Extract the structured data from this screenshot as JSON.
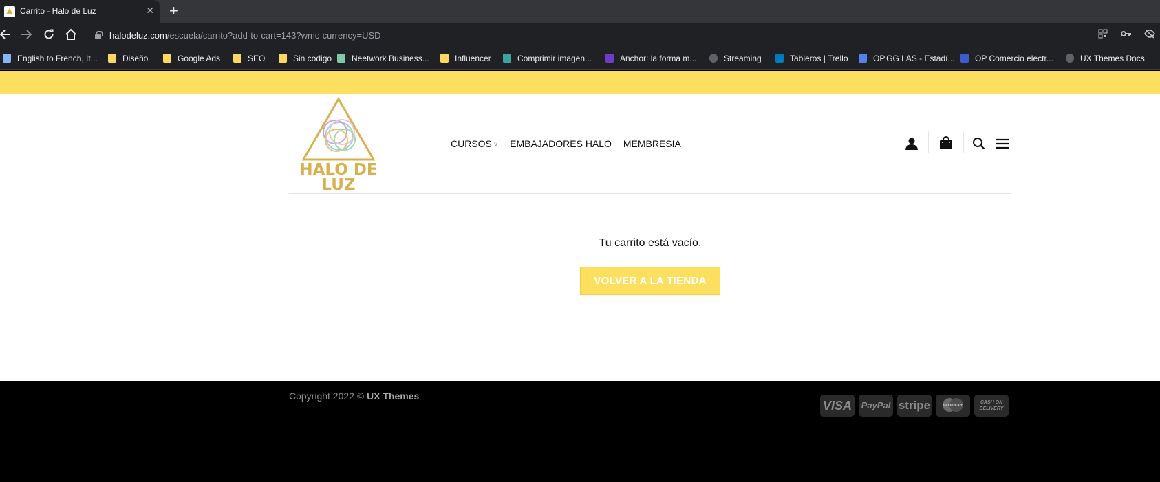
{
  "browser": {
    "tab_title": "Carrito - Halo de Luz",
    "close_glyph": "✕",
    "newtab_glyph": "+",
    "url_host": "halodeluz.com",
    "url_path": "/escuela/carrito?add-to-cart=143?wmc-currency=USD",
    "bookmarks": [
      {
        "label": "English to French, It...",
        "icon": "translate-icon",
        "color": "#8ab4f8"
      },
      {
        "label": "Diseño",
        "icon": "folder-icon",
        "color": "#fdd663"
      },
      {
        "label": "Google Ads",
        "icon": "folder-icon",
        "color": "#fdd663"
      },
      {
        "label": "SEO",
        "icon": "folder-icon",
        "color": "#fdd663"
      },
      {
        "label": "Sin codigo",
        "icon": "folder-icon",
        "color": "#fdd663"
      },
      {
        "label": "Neetwork Business...",
        "icon": "neetwork-icon",
        "color": "#7fc8a9"
      },
      {
        "label": "Influencer",
        "icon": "folder-icon",
        "color": "#fdd663"
      },
      {
        "label": "Comprimir imagen...",
        "icon": "leaf-icon",
        "color": "#3ba4a0"
      },
      {
        "label": "Anchor: la forma m...",
        "icon": "anchor-icon",
        "color": "#6e3cc7"
      },
      {
        "label": "Streaming",
        "icon": "globe-icon",
        "color": "#5f6368"
      },
      {
        "label": "Tableros | Trello",
        "icon": "trello-icon",
        "color": "#0079bf"
      },
      {
        "label": "OP.GG LAS - Estadí...",
        "icon": "opgg-icon",
        "color": "#5383e8"
      },
      {
        "label": "OP Comercio electr...",
        "icon": "op-icon",
        "color": "#3b5ccc"
      },
      {
        "label": "UX Themes Docs",
        "icon": "ux-icon",
        "color": "#5f6368"
      }
    ]
  },
  "site": {
    "logo_text": "HALO DE LUZ",
    "brand_color": "#d9b04f",
    "accent": "#fddf5f",
    "menu": [
      {
        "label": "CURSOS",
        "has_dropdown": true
      },
      {
        "label": "EMBAJADORES HALO",
        "has_dropdown": false
      },
      {
        "label": "MEMBRESIA",
        "has_dropdown": false
      }
    ],
    "cart": {
      "empty_message": "Tu carrito está vacío.",
      "return_button": "VOLVER A LA TIENDA"
    },
    "footer": {
      "copyright_prefix": "Copyright 2022 ©",
      "copyright_brand": "UX Themes",
      "payments": [
        "VISA",
        "PayPal",
        "stripe",
        "MasterCard",
        "CASH ON DELIVERY"
      ]
    }
  }
}
